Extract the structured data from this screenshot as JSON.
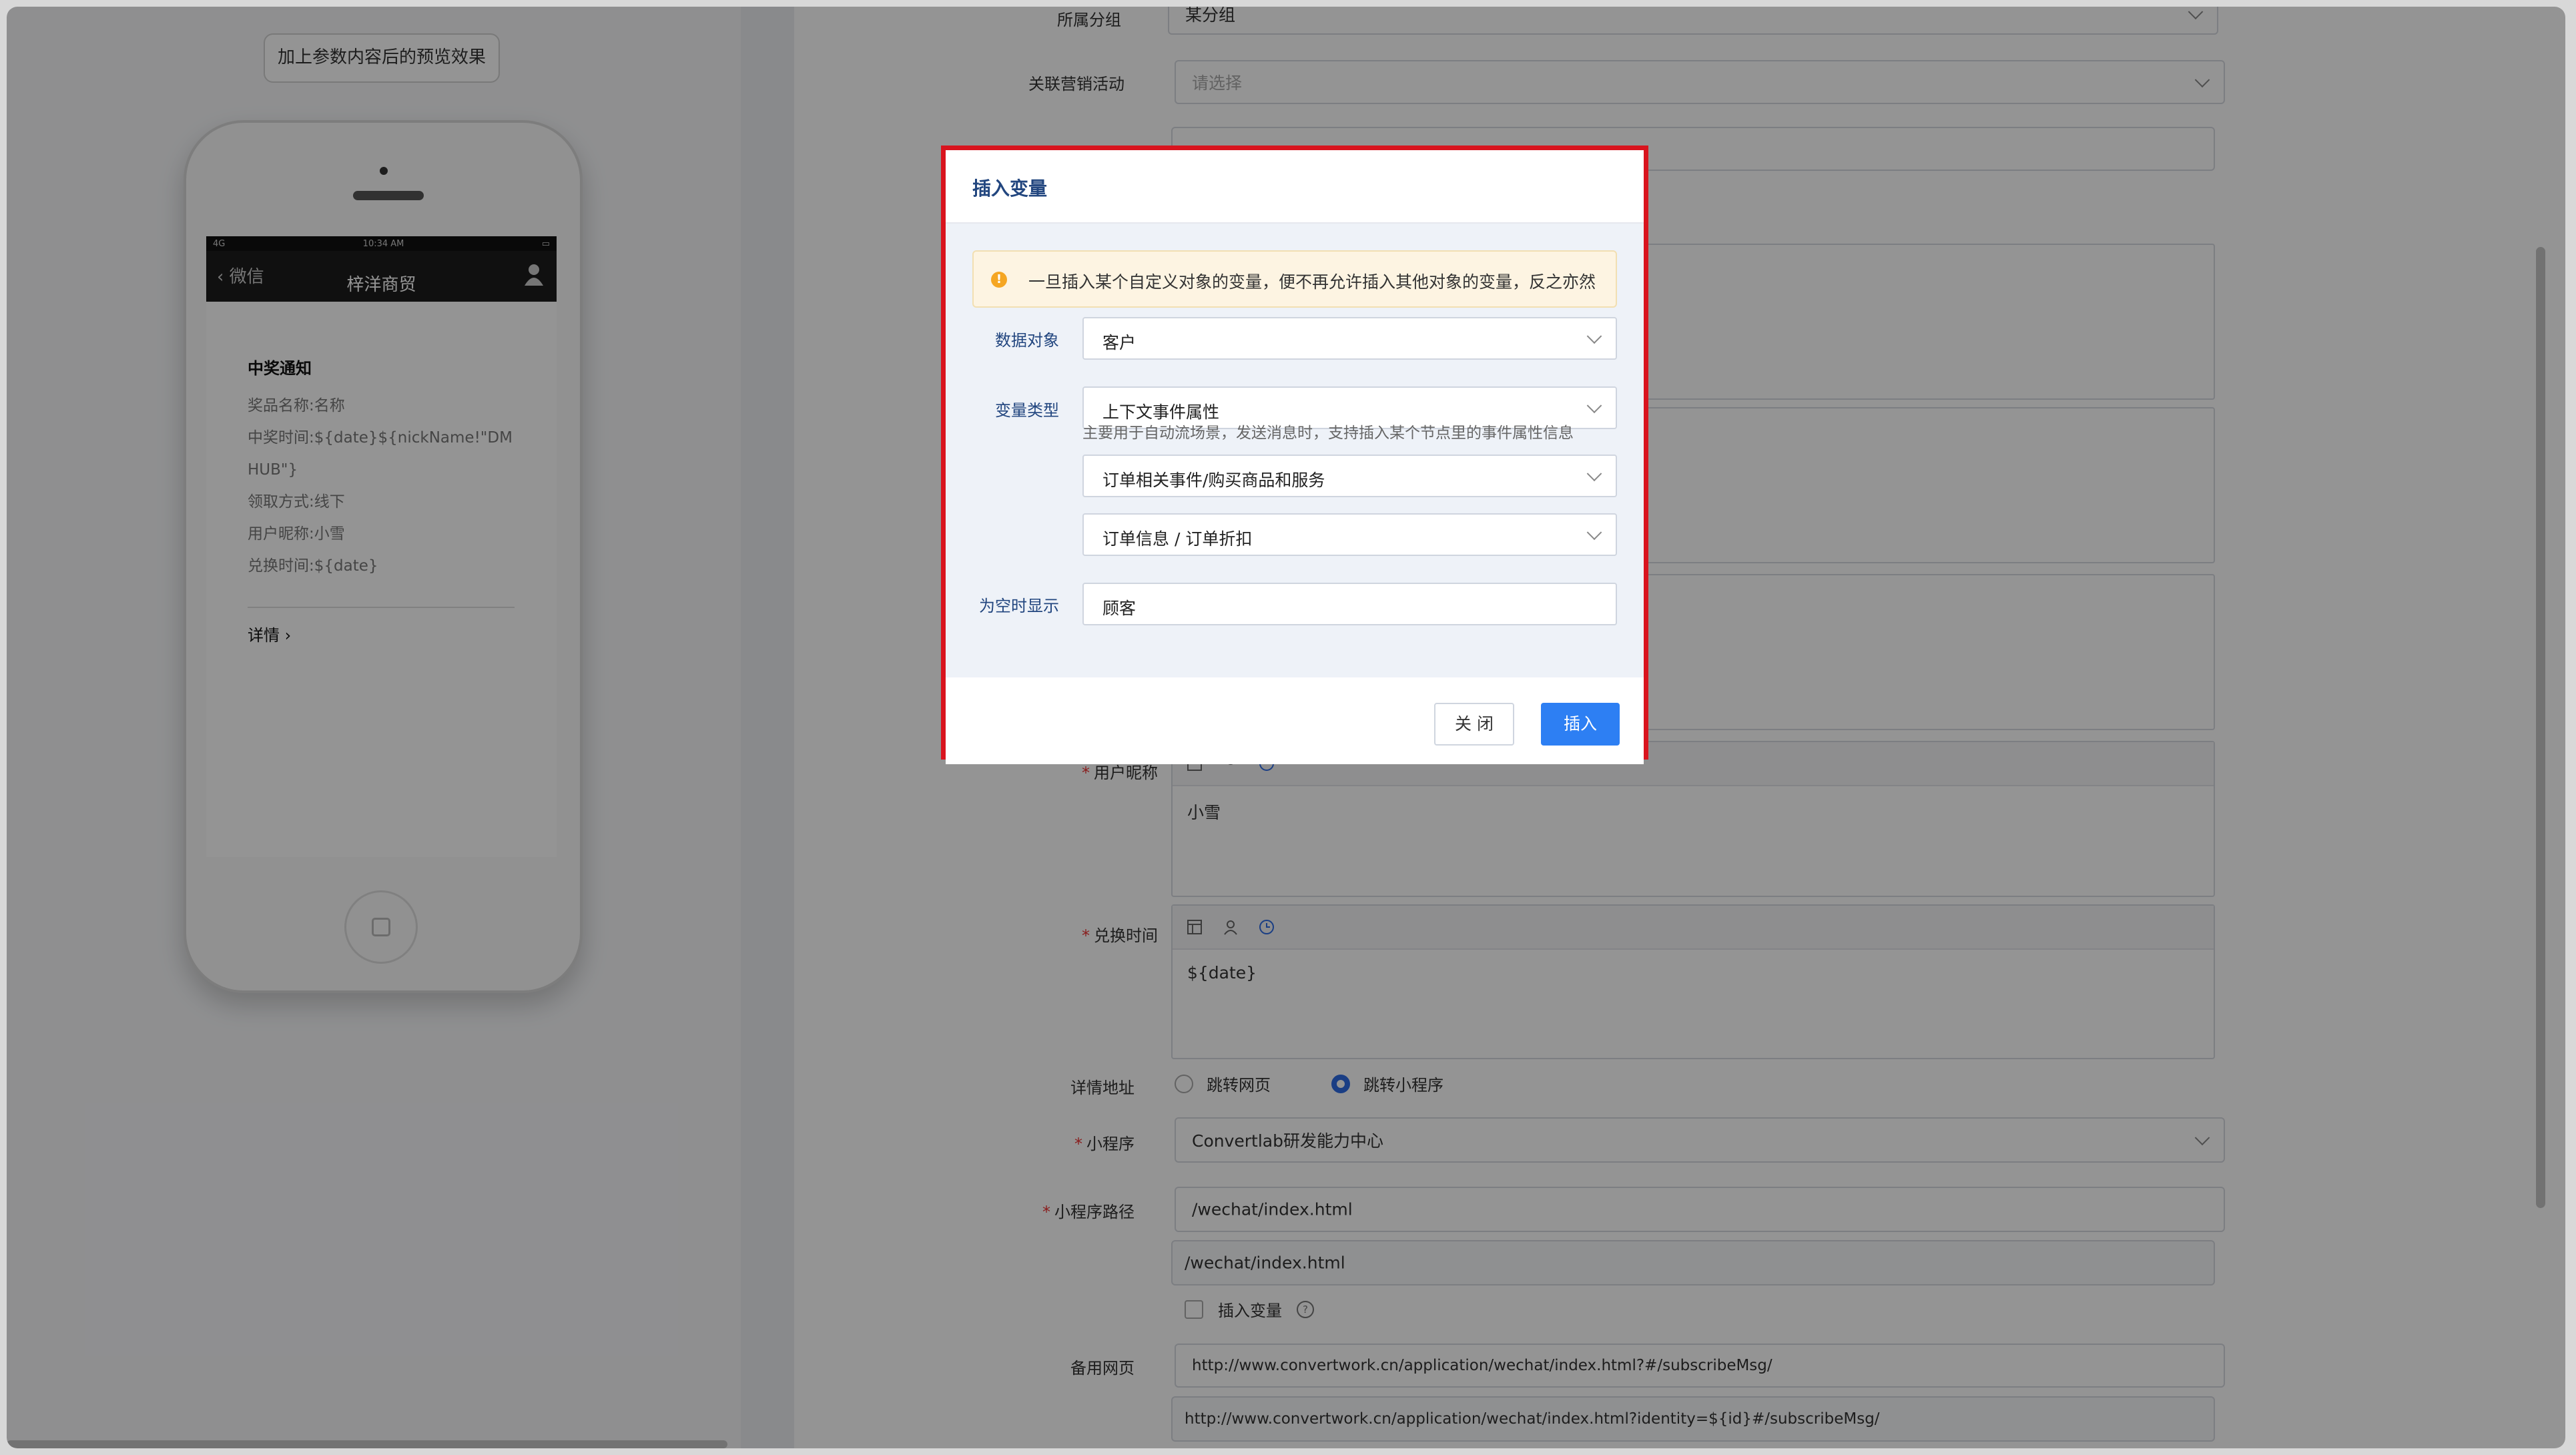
{
  "preview": {
    "button_label": "加上参数内容后的预览效果",
    "status": {
      "signal": "4G",
      "time": "10:34 AM"
    },
    "nav": {
      "back": "微信",
      "title": "梓洋商贸"
    },
    "card": {
      "title": "中奖通知",
      "lines": [
        "奖品名称:名称",
        "中奖时间:${date}${nickName!\"DM",
        "HUB\"}",
        "领取方式:线下",
        "用户昵称:小雪",
        "兑换时间:${date}"
      ],
      "detail": "详情"
    }
  },
  "form": {
    "group_label": "所属分组",
    "group_value": "某分组",
    "campaign_label": "关联营销活动",
    "campaign_placeholder": "请选择",
    "nickname_label": "用户昵称",
    "nickname_value": "小雪",
    "exchange_label": "兑换时间",
    "exchange_value": "${date}",
    "detail_label": "详情地址",
    "radio_web": "跳转网页",
    "radio_mini": "跳转小程序",
    "mini_label": "小程序",
    "mini_value": "Convertlab研发能力中心",
    "path_label": "小程序路径",
    "path_value": "/wechat/index.html",
    "path_preview": "/wechat/index.html",
    "insert_var_label": "插入变量",
    "backup_label": "备用网页",
    "backup_value": "http://www.convertwork.cn/application/wechat/index.html?#/subscribeMsg/",
    "backup_preview": "http://www.convertwork.cn/application/wechat/index.html?identity=${id}#/subscribeMsg/"
  },
  "modal": {
    "title": "插入变量",
    "alert": "一旦插入某个自定义对象的变量，便不再允许插入其他对象的变量，反之亦然",
    "data_object_label": "数据对象",
    "data_object_value": "客户",
    "var_type_label": "变量类型",
    "var_type_value": "上下文事件属性",
    "hint": "主要用于自动流场景，发送消息时，支持插入某个节点里的事件属性信息",
    "event_value": "订单相关事件/购买商品和服务",
    "attr_value": "订单信息 / 订单折扣",
    "empty_label": "为空时显示",
    "empty_value": "顾客",
    "close_label": "关 闭",
    "insert_label": "插入"
  },
  "colors": {
    "accent": "#2d7ff3",
    "highlight": "#d9141e",
    "label": "#22467f"
  }
}
